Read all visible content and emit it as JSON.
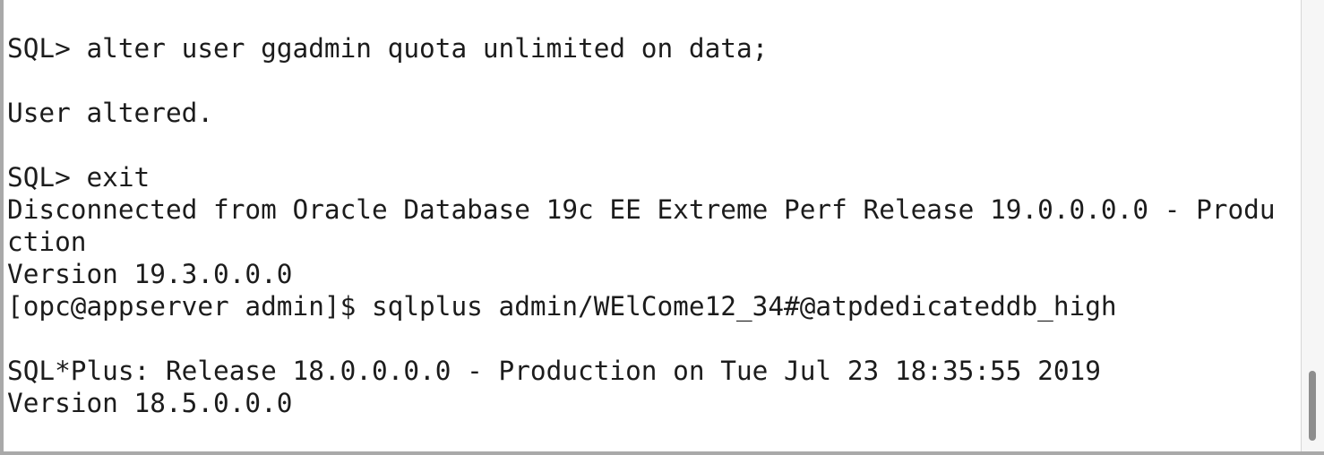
{
  "terminal": {
    "lines": [
      "",
      "SQL> alter user ggadmin quota unlimited on data;",
      "",
      "User altered.",
      "",
      "SQL> exit",
      "Disconnected from Oracle Database 19c EE Extreme Perf Release 19.0.0.0.0 - Produ",
      "ction",
      "Version 19.3.0.0.0",
      "[opc@appserver admin]$ sqlplus admin/WElCome12_34#@atpdedicateddb_high",
      "",
      "SQL*Plus: Release 18.0.0.0.0 - Production on Tue Jul 23 18:35:55 2019",
      "Version 18.5.0.0.0",
      ""
    ]
  },
  "scrollbar": {
    "position_fraction": 0.92
  }
}
